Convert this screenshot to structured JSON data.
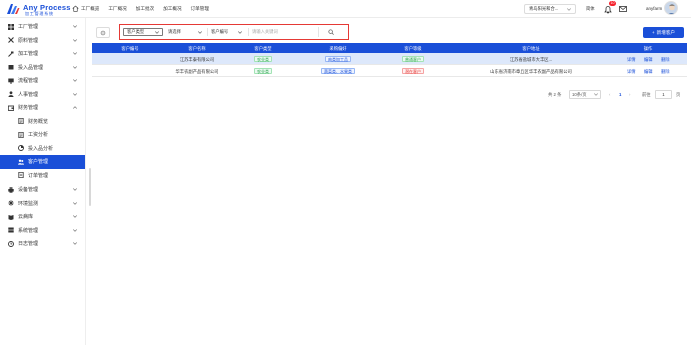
{
  "header": {
    "logo_title": "Any Process",
    "logo_subtitle": "加工管理系统",
    "nav": [
      "工厂概览",
      "工厂概况",
      "加工批次",
      "加工概况",
      "订单管理"
    ],
    "region": "青岛阳光和合...",
    "lang": "简体",
    "notification_count": "10",
    "username": "anyfarm"
  },
  "sidebar": {
    "items": [
      {
        "label": "工厂管理",
        "icon": "grid-icon"
      },
      {
        "label": "原料管理",
        "icon": "tools-icon"
      },
      {
        "label": "加工管理",
        "icon": "hammer-icon"
      },
      {
        "label": "投入品管理",
        "icon": "box-icon"
      },
      {
        "label": "流程管理",
        "icon": "monitor-icon"
      },
      {
        "label": "人事管理",
        "icon": "person-icon"
      },
      {
        "label": "财务管理",
        "icon": "wallet-icon"
      },
      {
        "label": "财务概览",
        "icon": "document-icon"
      },
      {
        "label": "工资分析",
        "icon": "document-icon"
      },
      {
        "label": "投入品分析",
        "icon": "pie-icon"
      },
      {
        "label": "客户管理",
        "icon": "users-icon"
      },
      {
        "label": "订单管理",
        "icon": "file-icon"
      },
      {
        "label": "设备管理",
        "icon": "printer-icon"
      },
      {
        "label": "环境监测",
        "icon": "sensor-icon"
      },
      {
        "label": "云病库",
        "icon": "book-icon"
      },
      {
        "label": "系统管理",
        "icon": "server-icon"
      },
      {
        "label": "日志管理",
        "icon": "log-icon"
      }
    ]
  },
  "filters": {
    "customer_type": "客户类型",
    "select_placeholder": "请选择",
    "customer_no": "客户编号",
    "search_placeholder": "请输入关键词"
  },
  "add_button": "新增客户",
  "table": {
    "columns": [
      "客户编号",
      "客户名称",
      "客户类型",
      "采购偏好",
      "客户等级",
      "客户地址",
      "操作"
    ],
    "rows": [
      {
        "no": "",
        "name": "江苏丰泰有限公司",
        "type": "农业类",
        "preference": "肉类加工品",
        "level": "普通客户",
        "address": "江苏省盐城市大丰区...",
        "actions": [
          "详情",
          "编辑",
          "删除"
        ]
      },
      {
        "no": "",
        "name": "华丰农副产品有限公司",
        "type": "农业类",
        "preference": "蔬菜类、水果类",
        "level": "潜在客户",
        "address": "山东省济南市章丘区华丰农副产品有限公司",
        "actions": [
          "详情",
          "编辑",
          "删除"
        ]
      }
    ]
  },
  "pager": {
    "total": "共 2 条",
    "page_size": "10条/页",
    "prev": "‹",
    "current": "1",
    "next": "›",
    "goto": "前往",
    "goto_value": "1",
    "page_unit": "页"
  },
  "colors": {
    "primary": "#1a4fd8",
    "highlight_row": "#dde8fb",
    "filter_border": "#e53935"
  }
}
